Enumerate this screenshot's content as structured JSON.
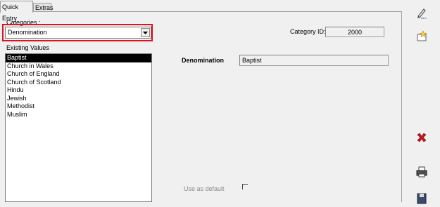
{
  "tabs": [
    {
      "label": "Quick Entry",
      "active": true
    },
    {
      "label": "Extras",
      "active": false
    }
  ],
  "categories": {
    "label": "Categories :",
    "selected": "Denomination"
  },
  "existing_values": {
    "label": "Existing Values",
    "items": [
      "Baptist",
      "Church in Wales",
      "Church of England",
      "Church of Scotland",
      "Hindu",
      "Jewish",
      "Methodist",
      "Muslim"
    ],
    "selected_index": 0
  },
  "category_id": {
    "label": "Category ID:",
    "value": "2000"
  },
  "detail": {
    "label": "Denomination",
    "value": "Baptist"
  },
  "use_as_default": {
    "label": "Use as default",
    "checked": false
  },
  "toolbar": {
    "icons": [
      "edit-pencil-icon",
      "new-star-icon",
      "delete-x-icon",
      "print-icon",
      "save-icon"
    ]
  },
  "colors": {
    "highlight": "#e0141e",
    "delete": "#c8141e",
    "selected_bg": "#000000"
  }
}
